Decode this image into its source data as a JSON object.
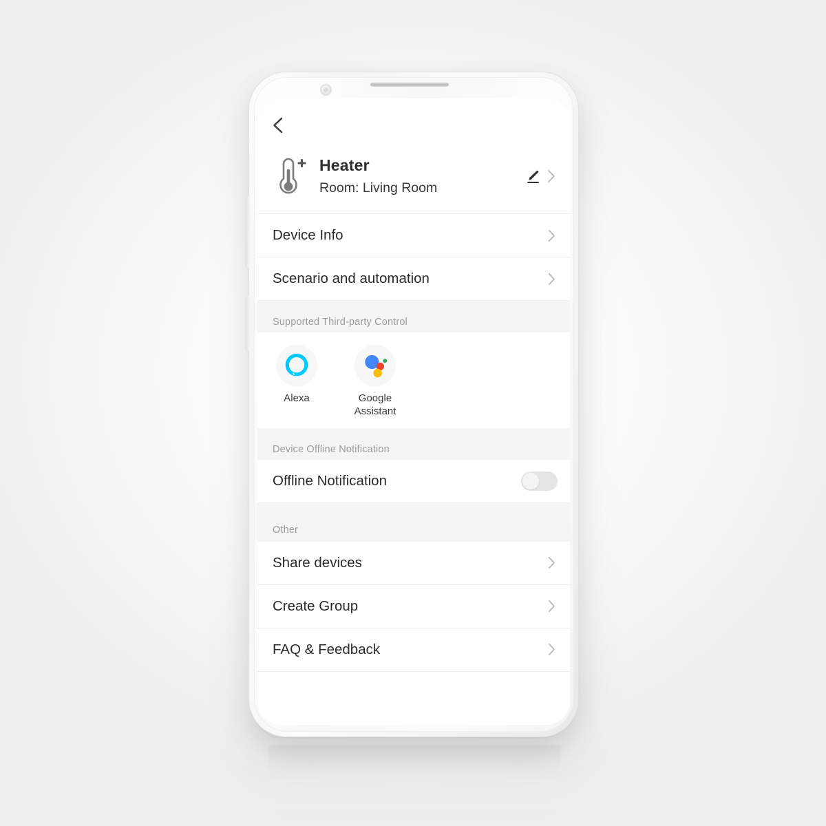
{
  "device": {
    "icon": "thermometer-plus-icon",
    "name": "Heater",
    "room": "Room: Living Room",
    "edit_icon": "pencil-icon",
    "chevron_icon": "chevron-right-icon"
  },
  "nav": {
    "back_icon": "chevron-left-icon"
  },
  "menu": [
    {
      "label": "Device Info"
    },
    {
      "label": "Scenario and automation"
    }
  ],
  "third_party": {
    "section_title": "Supported Third-party Control",
    "items": [
      {
        "label": "Alexa",
        "icon": "alexa-icon"
      },
      {
        "label": "Google\nAssistant",
        "line1": "Google",
        "line2": "Assistant",
        "icon": "google-assistant-icon"
      }
    ]
  },
  "offline": {
    "section_title": "Device Offline Notification",
    "row_label": "Offline Notification",
    "toggle_state": "off"
  },
  "other": {
    "section_title": "Other",
    "items": [
      {
        "label": "Share devices"
      },
      {
        "label": "Create Group"
      },
      {
        "label": "FAQ & Feedback"
      }
    ]
  },
  "colors": {
    "alexa_cyan": "#00caff",
    "google_blue": "#4285f4",
    "google_red": "#ea4335",
    "google_yellow": "#fbbc05",
    "google_green": "#34a853",
    "section_bg": "#f5f5f5",
    "text_primary": "#2b2b2b",
    "text_muted": "#9b9b9b"
  }
}
